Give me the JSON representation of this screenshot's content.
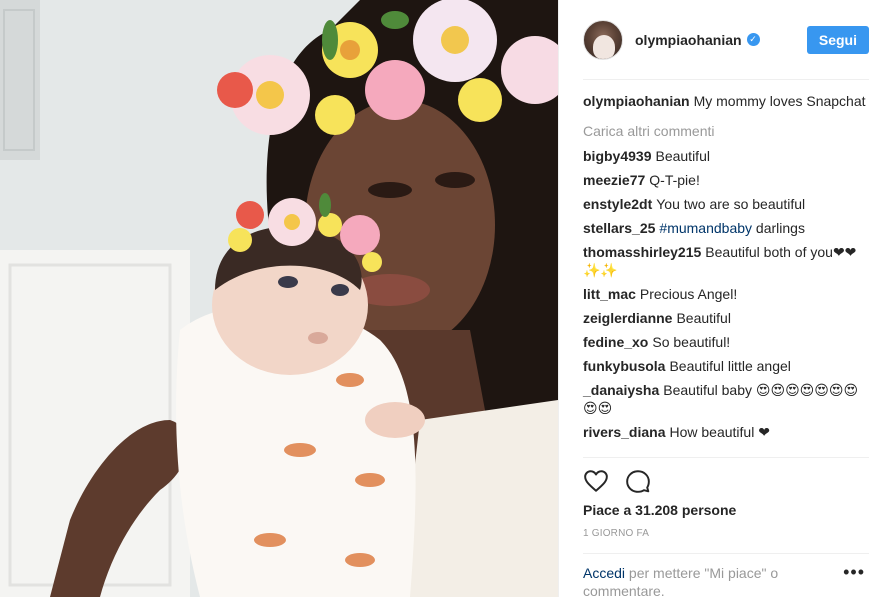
{
  "post": {
    "author": "olympiaohanian",
    "verified_icon": "verified-badge-icon",
    "follow_label": "Segui",
    "caption_user": "olympiaohanian",
    "caption_text": "My mommy loves Snapchat",
    "load_more": "Carica altri commenti",
    "comments": [
      {
        "user": "bigby4939",
        "text": "Beautiful"
      },
      {
        "user": "meezie77",
        "text": "Q-T-pie!"
      },
      {
        "user": "enstyle2dt",
        "text": "You two are so beautiful"
      },
      {
        "user": "stellars_25",
        "hashtag": "#mumandbaby",
        "text": "darlings"
      },
      {
        "user": "thomasshirley215",
        "text": "Beautiful both of you❤❤✨✨"
      },
      {
        "user": "litt_mac",
        "text": "Precious Angel!"
      },
      {
        "user": "zeiglerdianne",
        "text": "Beautiful"
      },
      {
        "user": "fedine_xo",
        "text": "So beautiful!"
      },
      {
        "user": "funkybusola",
        "text": "Beautiful little angel"
      },
      {
        "user": "_danaiysha",
        "text": "Beautiful baby 😍😍😍😍😍😍😍😍😍"
      },
      {
        "user": "rivers_diana",
        "text": "How beautiful ❤"
      }
    ],
    "likes_text": "Piace a 31.208 persone",
    "time": "1 GIORNO FA",
    "login_link": "Accedi",
    "login_rest": " per mettere \"Mi piace\" o commentare.",
    "icons": {
      "like": "heart-icon",
      "comment": "comment-icon",
      "more": "more-options-icon"
    },
    "more_symbol": "•••"
  },
  "colors": {
    "accent": "#3897f0",
    "text": "#262626",
    "muted": "#999999",
    "link": "#003569"
  }
}
